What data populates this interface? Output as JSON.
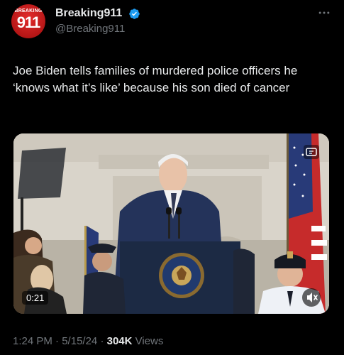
{
  "author": {
    "avatar_tag": "BREAKING",
    "avatar_number": "911",
    "display_name": "Breaking911",
    "handle": "@Breaking911",
    "verified_color": "#1d9bf0"
  },
  "tweet": {
    "text": "Joe Biden tells families of murdered police officers he ‘knows what it’s like’ because his son died of cancer"
  },
  "media": {
    "duration": "0:21",
    "podium_seal_text": "PRESIDENT OF THE UNITED STATES"
  },
  "meta": {
    "time": "1:24 PM",
    "separator1": "·",
    "date": "5/15/24",
    "separator2": "·",
    "views_count": "304K",
    "views_label": "Views"
  },
  "icons": {
    "more": "more-icon",
    "verified": "verified-badge-icon",
    "mute": "mute-icon",
    "gif": "gif-icon"
  }
}
